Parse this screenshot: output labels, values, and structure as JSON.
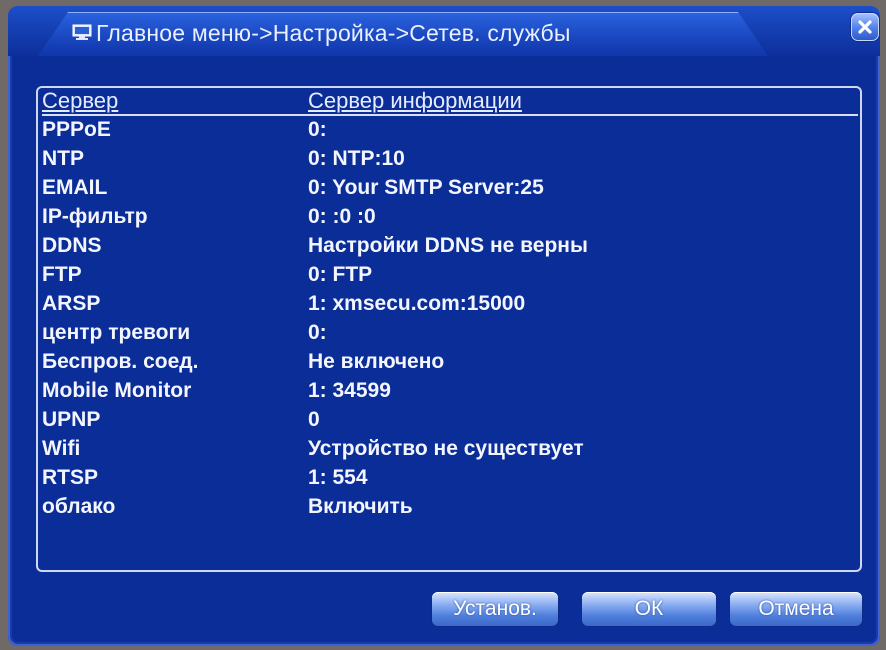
{
  "window": {
    "title": "Главное меню->Настройка->Сетев. службы"
  },
  "table": {
    "columns": [
      "Сервер",
      "Сервер информации"
    ],
    "rows": [
      [
        "PPPoE",
        "0:"
      ],
      [
        "NTP",
        "0: NTP:10"
      ],
      [
        "EMAIL",
        "0: Your SMTP Server:25"
      ],
      [
        "IP-фильтр",
        "0: :0 :0"
      ],
      [
        "DDNS",
        "Настройки DDNS не верны"
      ],
      [
        "FTP",
        "0: FTP"
      ],
      [
        "ARSP",
        "1: xmsecu.com:15000"
      ],
      [
        "центр тревоги",
        "0:"
      ],
      [
        "Беспров. соед.",
        "Не включено"
      ],
      [
        "Mobile Monitor",
        "1: 34599"
      ],
      [
        "UPNP",
        "0"
      ],
      [
        "Wifi",
        "Устройство не существует"
      ],
      [
        "RTSP",
        "1: 554"
      ],
      [
        "облако",
        "Включить"
      ]
    ]
  },
  "buttons": {
    "apply": "Установ.",
    "ok": "ОК",
    "cancel": "Отмена"
  },
  "icons": {
    "title": "monitor-icon",
    "close": "close-icon"
  },
  "colors": {
    "window_bg": "#0b2d97",
    "text": "#f4f6ff",
    "border": "#cfd8f0"
  }
}
